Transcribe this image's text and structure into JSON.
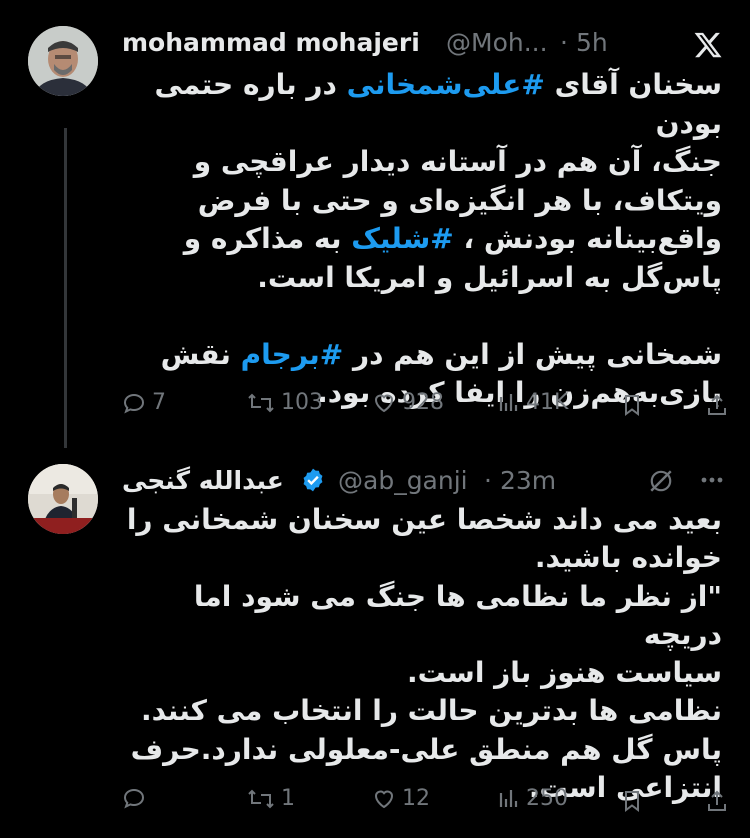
{
  "tweet1": {
    "author_name": "mohammad mohajeri",
    "handle": "@Moh...",
    "time": "5h",
    "lines": [
      {
        "pre": "سخنان آقای ",
        "tag": "#علی‌شمخانی",
        "post": " در باره حتمی بودن"
      },
      {
        "pre": "جنگ، آن هم در آستانه دیدار عراقچی و",
        "tag": "",
        "post": ""
      },
      {
        "pre": "ویتکاف، با هر انگیزه‌ای و حتی با فرض",
        "tag": "",
        "post": ""
      },
      {
        "pre": "واقع‌بینانه بودنش ، ",
        "tag": "#شلیک",
        "post": " به مذاکره و"
      },
      {
        "pre": "پاس‌گل به اسرائیل و امریکا است.",
        "tag": "",
        "post": ""
      },
      {
        "pre": "",
        "tag": "",
        "post": ""
      },
      {
        "pre": "شمخانی پیش از این هم در ",
        "tag": "#برجام",
        "post": " نقش"
      },
      {
        "pre": "بازی‌به‌هم‌زن را ایفا کرده بود.",
        "tag": "",
        "post": ""
      }
    ],
    "stats": {
      "replies": "7",
      "retweets": "103",
      "likes": "928",
      "views": "41K"
    }
  },
  "tweet2": {
    "author_name": "عبدالله گنجی",
    "handle": "@ab_ganji",
    "time": "23m",
    "lines": [
      "بعید می داند شخصا عین سخنان شمخانی را",
      "خوانده باشید.",
      "\"از نظر ما نظامی ها جنگ می شود اما دریچه",
      "سیاست هنوز باز است.",
      "نظامی ها بدترین حالت را انتخاب می کنند.",
      "پاس گل هم منطق علی-معلولی ندارد.حرف",
      "انتزاعی است."
    ],
    "stats": {
      "replies": "",
      "retweets": "1",
      "likes": "12",
      "views": "250"
    }
  },
  "colors": {
    "accent": "#1d9bf0",
    "muted": "#71767b",
    "text": "#e7e9ea",
    "background": "#000000"
  }
}
